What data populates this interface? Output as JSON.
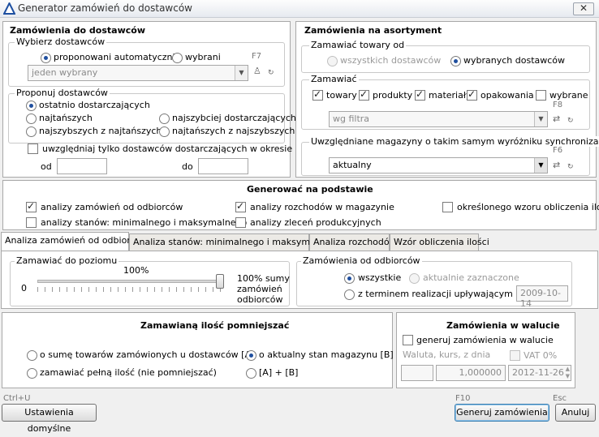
{
  "window": {
    "title": "Generator zamówień do dostawców",
    "close": "✕"
  },
  "left": {
    "title": "Zamówienia do dostawców",
    "choose_group": "Wybierz dostawców",
    "radio_auto": "proponowani automatycznie",
    "radio_selected": "wybrani",
    "f7": "F7",
    "selected_value": "jeden wybrany",
    "propose_group": "Proponuj dostawców",
    "opt_last": "ostatnio dostarczających",
    "opt_cheapest": "najtańszych",
    "opt_fastest": "najszybciej dostarczających",
    "opt_fastest_cheap": "najszybszych z najtańszych",
    "opt_cheap_fastest": "najtańszych z najszybszych",
    "only_in_period": "uwzględniaj tylko dostawców dostarczających w okresie",
    "from": "od",
    "to": "do",
    "from_value": "",
    "to_value": ""
  },
  "right": {
    "title": "Zamówienia na asortyment",
    "order_from_group": "Zamawiać towary od",
    "all_suppliers": "wszystkich dostawców",
    "selected_suppliers": "wybranych dostawców",
    "order_group": "Zamawiać",
    "goods": "towary",
    "products": "produkty",
    "materials": "materiały",
    "packaging": "opakowania",
    "selected": "wybrane",
    "f8": "F8",
    "filter_value": "wg filtra",
    "warehouses_group": "Uwzględniane magazyny o takim samym wyróżniku synchronizacji",
    "f6": "F6",
    "warehouse_value": "aktualny"
  },
  "generate": {
    "title": "Generować na podstawie",
    "orders_from_customers": "analizy zamówień od odbiorców",
    "outflows": "analizy rozchodów w magazynie",
    "formula": "określonego wzoru obliczenia ilości",
    "stock_levels": "analizy stanów: minimalnego i maksymalnego",
    "production": "analizy zleceń produkcyjnych"
  },
  "tabs": [
    "Analiza zamówień od odbiorców",
    "Analiza stanów: minimalnego i maksymalnego",
    "Analiza rozchodów",
    "Wzór obliczenia ilości"
  ],
  "tab_content": {
    "level_group": "Zamawiać do poziomu",
    "percent": "100%",
    "zero": "0",
    "slider_value_pct": 100,
    "sum_label_1": "100% sumy",
    "sum_label_2": "zamówień",
    "sum_label_3": "odbiorców",
    "customer_orders_group": "Zamówienia od odbiorców",
    "all": "wszystkie",
    "currently_selected": "aktualnie zaznaczone",
    "deadline": "z terminem realizacji upływającym dnia",
    "deadline_value": "2009-10-14"
  },
  "reduce": {
    "title": "Zamawianą ilość pomniejszać",
    "opt_a": "o sumę towarów zamówionych u dostawców [A]",
    "opt_b": "o aktualny stan magazynu [B]",
    "opt_full": "zamawiać pełną ilość (nie pomniejszać)",
    "opt_ab": "[A] + [B]"
  },
  "currency": {
    "title": "Zamówienia w walucie",
    "generate_in_currency": "generuj zamówienia w walucie",
    "currency_label": "Waluta, kurs, z dnia",
    "vat": "VAT 0%",
    "currency_value": "",
    "rate_value": "1,000000",
    "date_value": "2012-11-26"
  },
  "footer": {
    "ctrl_u": "Ctrl+U",
    "defaults": "Ustawienia domyślne",
    "f10": "F10",
    "generate": "Generuj zamówienia",
    "esc": "Esc",
    "cancel": "Anuluj"
  }
}
